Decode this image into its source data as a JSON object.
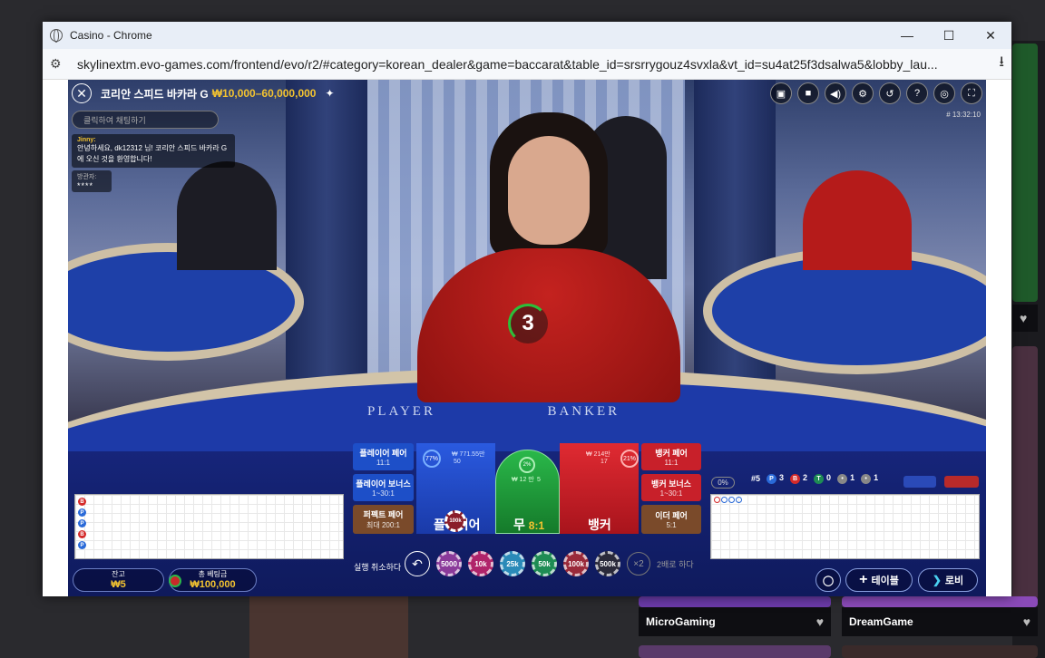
{
  "window": {
    "title": "Casino - Chrome",
    "url": "skylinextm.evo-games.com/frontend/evo/r2/#category=korean_dealer&game=baccarat&table_id=srsrrygouz4svxla&vt_id=su4at25f3dsalwa5&lobby_lau..."
  },
  "game": {
    "table_name": "코리안 스피드 바카라 G",
    "limits": "₩10,000–60,000,000",
    "time": "# 13:32:10",
    "countdown": "3",
    "chat_placeholder": "클릭하여 채팅하기",
    "chat": [
      {
        "user": "Jinny:",
        "message": "안녕하세요, dk12312 님! 코리안 스피드 바카라 G에 오신 것을 환영합니다!"
      },
      {
        "user": "방관자:",
        "message": "****"
      }
    ],
    "felt_labels": [
      "PLAYER",
      "BANKER"
    ]
  },
  "bets": {
    "player_pair": {
      "label": "플레이어 페어",
      "odds": "11:1"
    },
    "player_bonus": {
      "label": "플레이어 보너스",
      "odds": "1~30:1"
    },
    "perfect_pair": {
      "label": "퍼펙트 페어",
      "odds": "최대 200:1"
    },
    "banker_pair": {
      "label": "뱅커 페어",
      "odds": "11:1"
    },
    "banker_bonus": {
      "label": "뱅커 보너스",
      "odds": "1~30:1"
    },
    "either_pair": {
      "label": "이더 페어",
      "odds": "5:1"
    },
    "player": {
      "label": "플레이어",
      "pct": "77%",
      "amount": "₩ 771.55만",
      "players": "50"
    },
    "tie": {
      "label": "무",
      "odds": "8:1",
      "pct": "2%",
      "amount": "₩ 12 만",
      "players": "5"
    },
    "banker": {
      "label": "뱅커",
      "pct": "21%",
      "amount": "₩ 214만",
      "players": "17"
    },
    "placed_chip": "100k"
  },
  "chips": {
    "undo_label": "실행 취소하다",
    "values": [
      "5000",
      "10k",
      "25k",
      "50k",
      "100k",
      "500k"
    ],
    "colors": [
      "#8a3a9a",
      "#b0246a",
      "#2a8ab8",
      "#1e8c54",
      "#9a2a3a",
      "#2a2a3a"
    ],
    "double": "×2",
    "double_label": "2배로 하다"
  },
  "balance": {
    "label": "잔고",
    "value": "₩5",
    "total_label": "총 베팅금",
    "total_value": "₩100,000"
  },
  "stats": {
    "count": "#5",
    "player": "3",
    "banker": "2",
    "tie": "0",
    "p_pair": "1",
    "b_pair": "1",
    "pct": "0%"
  },
  "road_left": [
    "B",
    "P",
    "P",
    "B",
    "P"
  ],
  "road_left_colors": [
    "#d42a2a",
    "#2a6ad8",
    "#2a6ad8",
    "#d42a2a",
    "#2a6ad8"
  ],
  "buttons": {
    "table": "테이블",
    "lobby": "로비"
  },
  "background": {
    "cards": [
      "MicroGaming",
      "DreamGame"
    ]
  }
}
